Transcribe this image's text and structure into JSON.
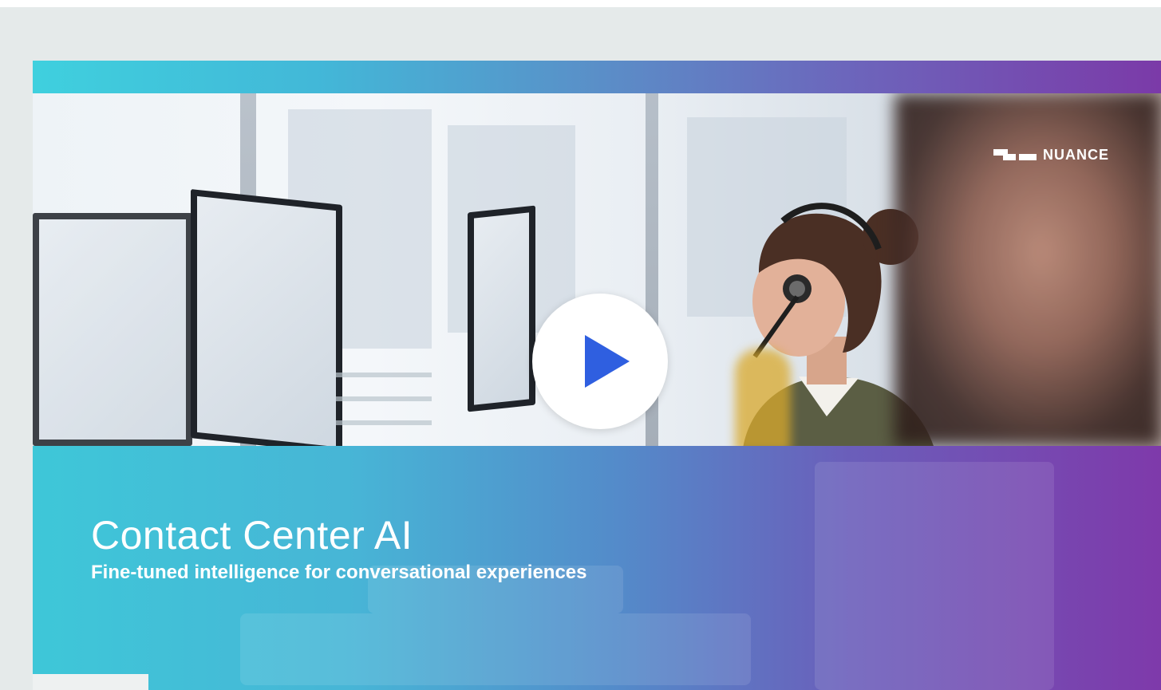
{
  "video": {
    "title": "Contact Center AI",
    "subtitle": "Fine-tuned intelligence for conversational experiences",
    "brand": "NUANCE",
    "play_icon": "play-icon",
    "logo_icon": "nuance-logo-icon"
  },
  "colors": {
    "gradient_start": "#3ec7d8",
    "gradient_end": "#8232a8",
    "play_triangle": "#2f5fe0",
    "page_background": "#e5eaea"
  }
}
